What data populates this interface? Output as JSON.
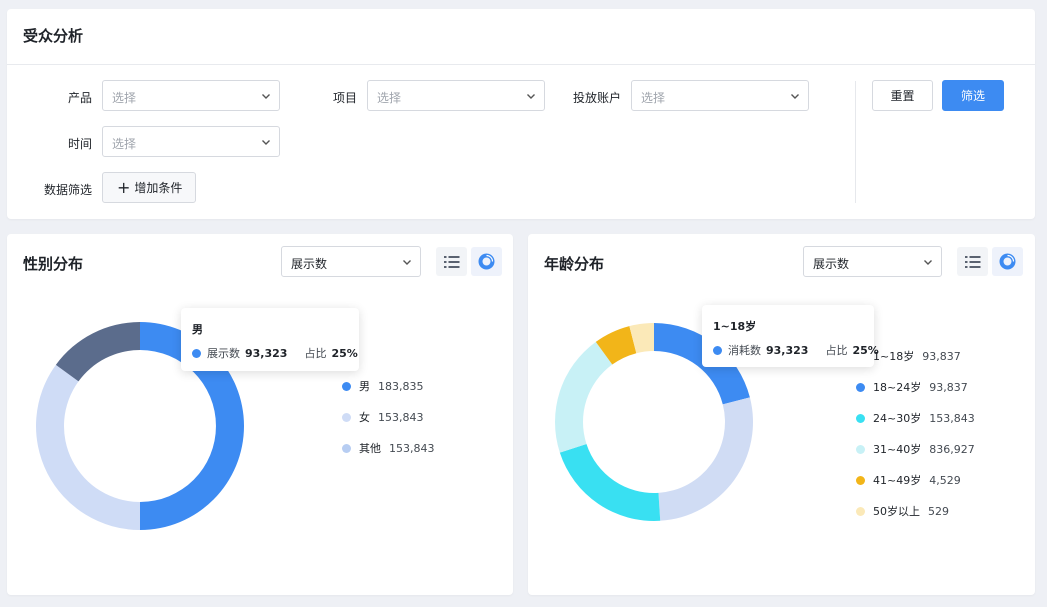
{
  "page": {
    "title": "受众分析"
  },
  "filters": {
    "product": {
      "label": "产品",
      "placeholder": "选择"
    },
    "project": {
      "label": "项目",
      "placeholder": "选择"
    },
    "account": {
      "label": "投放账户",
      "placeholder": "选择"
    },
    "time": {
      "label": "时间",
      "placeholder": "选择"
    },
    "data_filter": {
      "label": "数据筛选",
      "add_button": "增加条件"
    }
  },
  "buttons": {
    "reset": "重置",
    "filter": "筛选"
  },
  "gender": {
    "title": "性别分布",
    "metric_select": "展示数",
    "legend": [
      {
        "label": "男",
        "value": "183,835",
        "color": "#3d8bf2"
      },
      {
        "label": "女",
        "value": "153,843",
        "color": "#cfdcf6"
      },
      {
        "label": "其他",
        "value": "153,843",
        "color": "#b7cdf2"
      }
    ],
    "tooltip": {
      "title": "男",
      "metric_label": "展示数",
      "metric_value": "93,323",
      "ratio_label": "占比",
      "ratio_value": "25%"
    }
  },
  "age": {
    "title": "年龄分布",
    "metric_select": "展示数",
    "legend": [
      {
        "label": "1~18岁",
        "value": "93,837",
        "color": "#4a86e8"
      },
      {
        "label": "18~24岁",
        "value": "93,837",
        "color": "#3d8bf2"
      },
      {
        "label": "24~30岁",
        "value": "153,843",
        "color": "#39e0f2"
      },
      {
        "label": "31~40岁",
        "value": "836,927",
        "color": "#c8f1f6"
      },
      {
        "label": "41~49岁",
        "value": "4,529",
        "color": "#f2b519"
      },
      {
        "label": "50岁以上",
        "value": "529",
        "color": "#fbe9b8"
      }
    ],
    "tooltip": {
      "title": "1~18岁",
      "metric_label": "消耗数",
      "metric_value": "93,323",
      "ratio_label": "占比",
      "ratio_value": "25%"
    }
  },
  "chart_data": [
    {
      "type": "pie",
      "variant": "donut",
      "categories": [
        "男",
        "女",
        "其他"
      ],
      "values": [
        50,
        35,
        15
      ],
      "colors": [
        "#3d8bf2",
        "#cfdcf6",
        "#5b6c8c"
      ]
    },
    {
      "type": "pie",
      "variant": "donut",
      "categories": [
        "1~18岁",
        "24~30岁",
        "31~40岁",
        "41~49岁",
        "50岁以上",
        "18~24岁"
      ],
      "values": [
        21,
        28,
        21,
        20,
        6,
        4
      ],
      "colors": [
        "#3d8bf2",
        "#d0dcf4",
        "#39e0f2",
        "#c8f1f6",
        "#f2b519",
        "#fbe9b8"
      ]
    }
  ]
}
